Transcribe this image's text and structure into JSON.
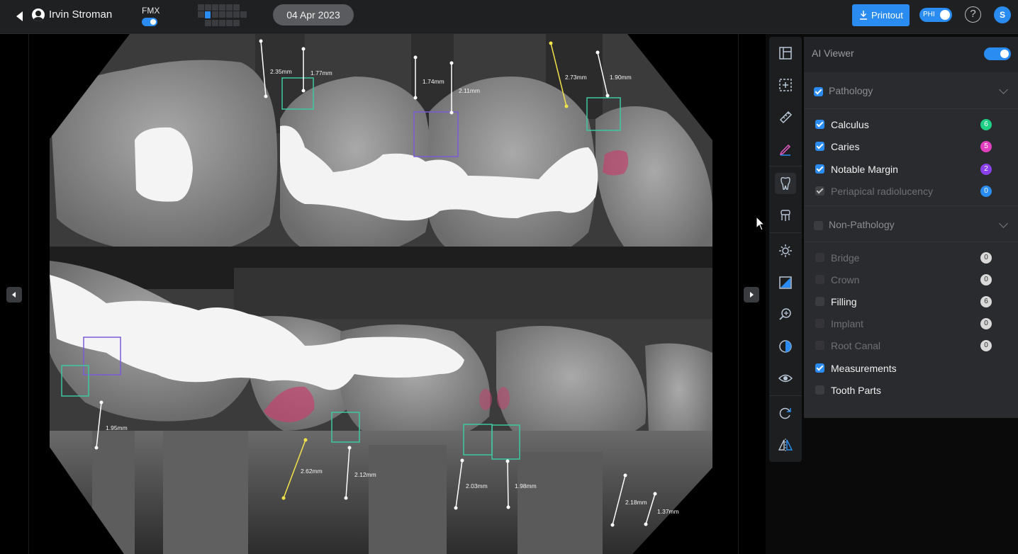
{
  "header": {
    "patient_name": "Irvin Stroman",
    "fmx_label": "FMX",
    "date": "04 Apr 2023",
    "printout_label": "Printout",
    "phi_label": "PHI",
    "help_label": "?",
    "user_initial": "S"
  },
  "measurements": [
    {
      "label": "2.35mm"
    },
    {
      "label": "1.77mm"
    },
    {
      "label": "1.74mm"
    },
    {
      "label": "2.11mm"
    },
    {
      "label": "2.73mm"
    },
    {
      "label": "1.90mm"
    },
    {
      "label": "1.95mm"
    },
    {
      "label": "2.62mm"
    },
    {
      "label": "2.12mm"
    },
    {
      "label": "2.03mm"
    },
    {
      "label": "1.98mm"
    },
    {
      "label": "2.18mm"
    },
    {
      "label": "1.37mm"
    }
  ],
  "toolbar": {
    "tools": [
      "layout-icon",
      "select-box-icon",
      "ruler-icon",
      "pencil-icon",
      "tooth-icon",
      "crown-icon",
      "brightness-icon",
      "image-adjust-icon",
      "zoom-icon",
      "contrast-icon",
      "eye-icon",
      "rotate-icon",
      "flip-icon"
    ]
  },
  "ai_panel": {
    "title": "AI Viewer",
    "pathology": {
      "title": "Pathology",
      "items": [
        {
          "label": "Calculus",
          "count": "6",
          "color": "#1fcf86",
          "checked": true
        },
        {
          "label": "Caries",
          "count": "5",
          "color": "#e23fc0",
          "checked": true
        },
        {
          "label": "Notable Margin",
          "count": "2",
          "color": "#8a3fe8",
          "checked": true
        },
        {
          "label": "Periapical radiolucency",
          "count": "0",
          "color": "#2a8cf0",
          "checked": true
        }
      ]
    },
    "non_pathology": {
      "title": "Non-Pathology",
      "items": [
        {
          "label": "Bridge",
          "count": "0"
        },
        {
          "label": "Crown",
          "count": "0"
        },
        {
          "label": "Filling",
          "count": "6"
        },
        {
          "label": "Implant",
          "count": "0"
        },
        {
          "label": "Root Canal",
          "count": "0"
        },
        {
          "label": "Measurements",
          "count": ""
        },
        {
          "label": "Tooth Parts",
          "count": ""
        }
      ]
    }
  },
  "colors": {
    "accent": "#2a8cf0",
    "calculus_box": "#3fc7a0",
    "margin_box": "#7b5bd6",
    "caries_fill": "#c0456f",
    "measure_highlight": "#f3e34a"
  }
}
